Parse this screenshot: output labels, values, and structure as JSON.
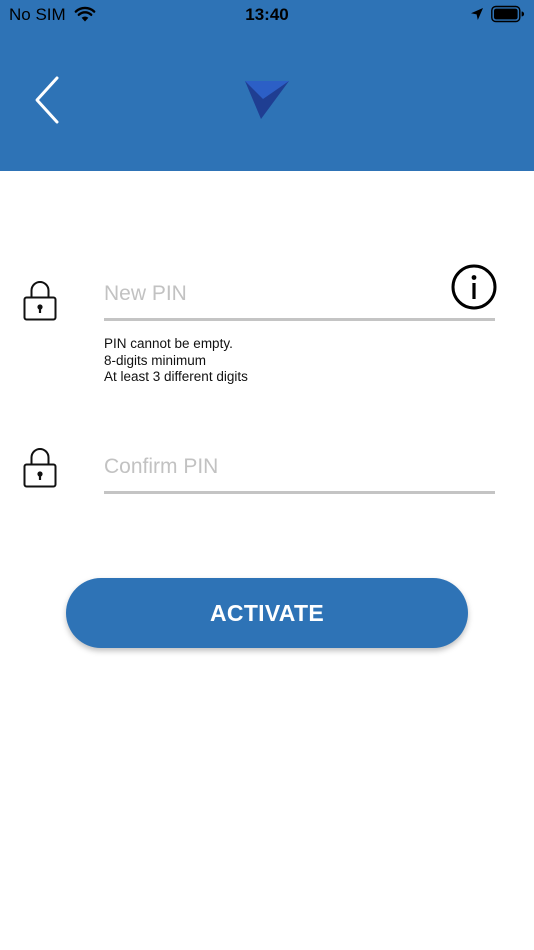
{
  "status_bar": {
    "carrier": "No SIM",
    "time": "13:40"
  },
  "colors": {
    "header": "#2e73b6",
    "button": "#2e73b6",
    "underline": "#c4c4c4"
  },
  "form": {
    "new_pin": {
      "value": "",
      "placeholder": "New PIN"
    },
    "hints": [
      "PIN cannot be empty.",
      "8-digits minimum",
      "At least 3 different digits"
    ],
    "confirm_pin": {
      "value": "",
      "placeholder": "Confirm PIN"
    },
    "activate_label": "ACTIVATE"
  },
  "icons": {
    "status": [
      "wifi-icon",
      "location-arrow-icon",
      "battery-icon"
    ],
    "header": [
      "back-chevron-icon",
      "app-logo-icon"
    ],
    "form": [
      "lock-icon",
      "info-icon",
      "lock-icon"
    ]
  }
}
